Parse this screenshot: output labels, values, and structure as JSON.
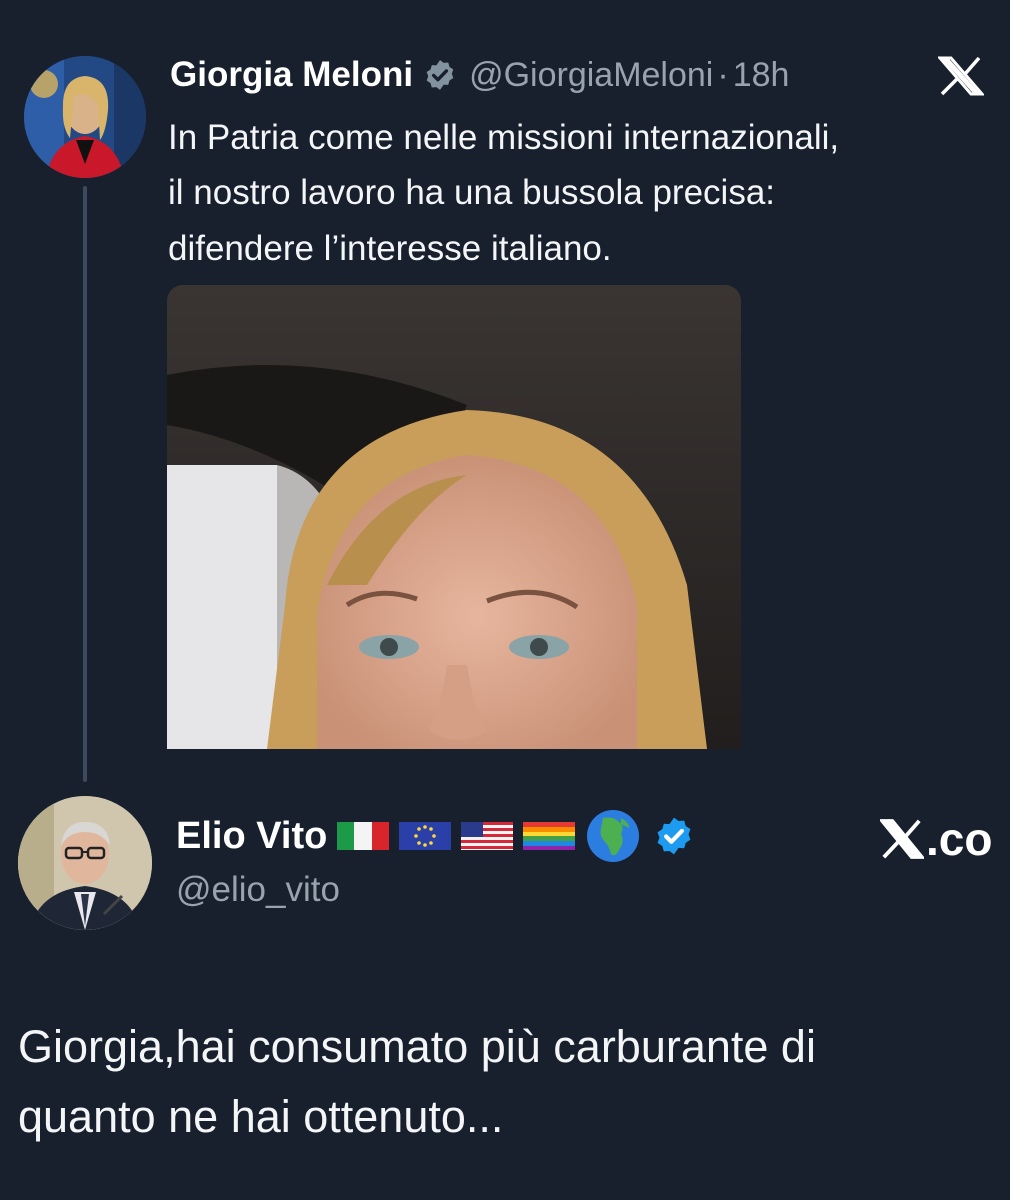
{
  "tweet": {
    "author_name": "Giorgia Meloni",
    "author_handle": "@GiorgiaMeloni",
    "separator": "·",
    "timestamp": "18h",
    "text_lines": [
      "In Patria come nelle missioni internazionali,",
      "il nostro lavoro ha una bussola precisa:",
      "difendere l’interesse italiano."
    ],
    "verified_badge_icon": "verified-grey-badge-icon",
    "platform_logo_icon": "x-logo-icon"
  },
  "reply": {
    "author_name": "Elio Vito",
    "author_handle": "@elio_vito",
    "badge_icons": [
      "italy-flag-icon",
      "eu-flag-icon",
      "us-flag-icon",
      "rainbow-flag-icon",
      "globe-africa-icon",
      "verified-blue-badge-icon"
    ],
    "watermark": ".co",
    "text_lines": [
      "Giorgia,hai consumato più carburante di",
      "quanto ne hai ottenuto..."
    ]
  },
  "colors": {
    "background": "#17202c",
    "secondary_text": "#98a3ae",
    "verified_blue": "#1d9bf0",
    "thread_line": "#3b4b5d"
  }
}
